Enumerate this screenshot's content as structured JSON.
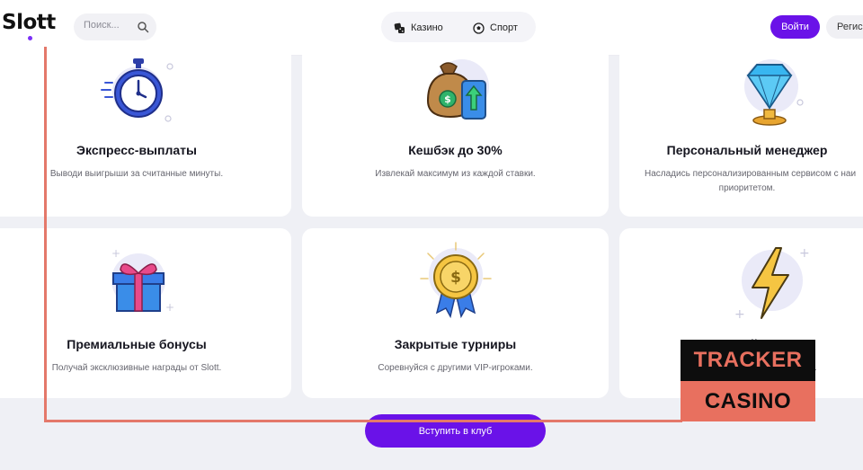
{
  "header": {
    "logo": "Slott",
    "search_placeholder": "Поиск...",
    "nav": [
      {
        "label": "Казино",
        "icon": "dice-icon"
      },
      {
        "label": "Спорт",
        "icon": "soccer-ball-icon"
      }
    ],
    "login": "Войти",
    "register": "Регис"
  },
  "features": [
    {
      "title": "Экспресс-выплаты",
      "desc": "Выводи выигрыши за считанные минуты.",
      "icon": "stopwatch-icon"
    },
    {
      "title": "Кешбэк до 30%",
      "desc": "Извлекай максимум из каждой ставки.",
      "icon": "money-bag-icon"
    },
    {
      "title": "Персональный менеджер",
      "desc_line1": "Насладись персонализированным сервисом с наи",
      "desc_line2": "приоритетом.",
      "icon": "diamond-icon"
    },
    {
      "title": "Премиальные бонусы",
      "desc": "Получай эксклюзивные награды от Slott.",
      "icon": "gift-icon"
    },
    {
      "title": "Закрытые турниры",
      "desc": "Соревнуйся с другими VIP-игроками.",
      "icon": "medal-icon"
    },
    {
      "title_partial": "...ый ...н",
      "desc_partial": "ше всех.",
      "icon": "lightning-icon"
    }
  ],
  "cta": "Вступить в клуб",
  "overlay": {
    "line1": "TRACKER",
    "line2": "CASINO"
  },
  "colors": {
    "accent": "#6a12e8",
    "overlay_red": "#e8705f"
  }
}
